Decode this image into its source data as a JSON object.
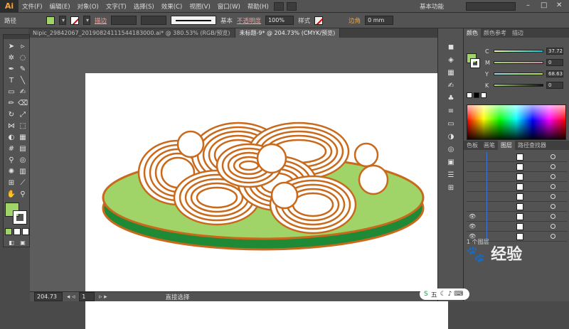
{
  "app": {
    "logo": "Ai",
    "menu": [
      "文件(F)",
      "编辑(E)",
      "对象(O)",
      "文字(T)",
      "选择(S)",
      "效果(C)",
      "视图(V)",
      "窗口(W)",
      "帮助(H)"
    ],
    "workspace_label": "基本功能",
    "window_controls": [
      "–",
      "□",
      "✕"
    ]
  },
  "control_bar": {
    "object_type": "路径",
    "stroke_label": "描边",
    "stroke_style": "基本",
    "opacity_label": "不透明度",
    "opacity_value": "100%",
    "style_label": "样式",
    "corner_label": "边角",
    "corner_value": "0 mm"
  },
  "documents": {
    "tabs": [
      {
        "label": "Nipic_29842067_20190824111544183000.ai* @ 380.53% (RGB/预览)",
        "active": false
      },
      {
        "label": "未标题-9* @ 204.73% (CMYK/预览)",
        "active": true
      }
    ]
  },
  "status_bar": {
    "zoom": "204.73",
    "page": "1",
    "tool_name": "直接选择"
  },
  "color_panel": {
    "tabs": [
      "颜色",
      "颜色参考",
      "描边"
    ],
    "channels": [
      {
        "name": "C",
        "value": "37.72"
      },
      {
        "name": "M",
        "value": "0"
      },
      {
        "name": "Y",
        "value": "68.63"
      },
      {
        "name": "K",
        "value": "0"
      }
    ],
    "fill_color": "#a0d468"
  },
  "layers_panel": {
    "tabs": [
      "色板",
      "画笔",
      "图层",
      "路径查找器"
    ],
    "active_tab": "图层",
    "count_label": "1 个图层"
  },
  "artwork": {
    "plate_color": "#a0d468",
    "plate_rim_color": "#1f8a36",
    "outline_color": "#c8691c",
    "noodle_fill": "#ffffff"
  },
  "watermark": {
    "text": "经验",
    "ime_label": "五"
  }
}
